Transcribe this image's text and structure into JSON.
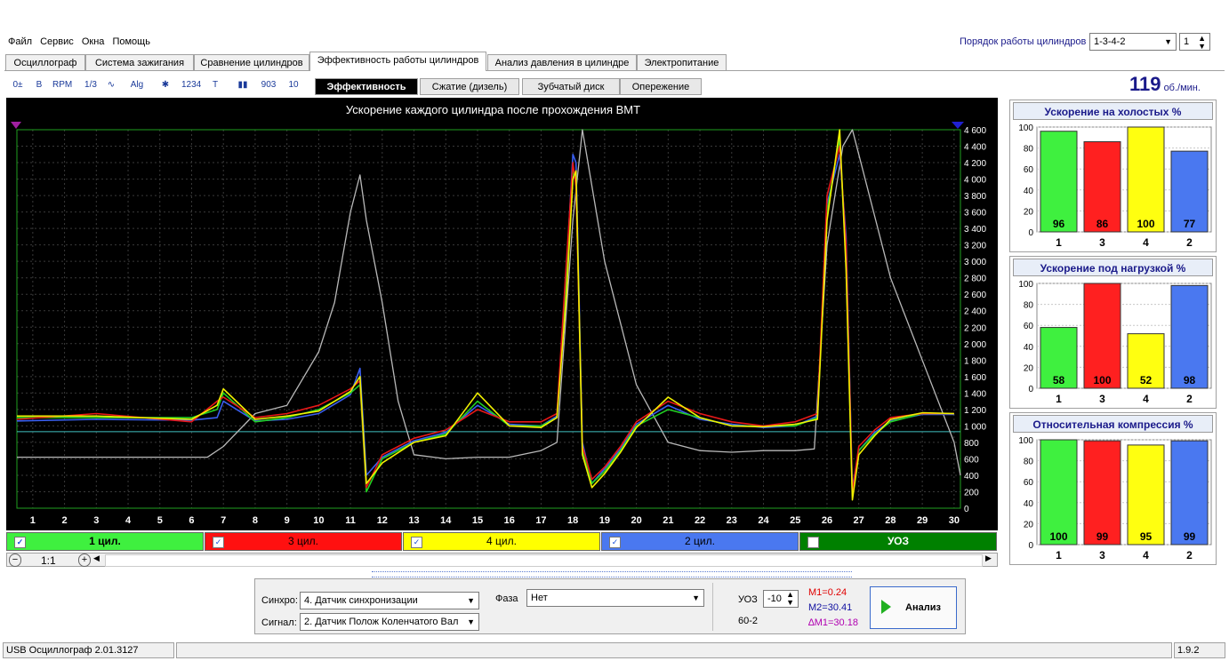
{
  "menu": [
    "Файл",
    "Сервис",
    "Окна",
    "Помощь"
  ],
  "cyl_order": {
    "label": "Порядок работы цилиндров",
    "value": "1-3-4-2",
    "spin_value": "1"
  },
  "tabs": [
    "Осциллограф",
    "Система зажигания",
    "Сравнение цилиндров",
    "Эффективность работы цилиндров",
    "Анализ давления в цилиндре",
    "Электропитание"
  ],
  "toolbar_icons": [
    "zero-offset-icon",
    "bold-icon",
    "rpm-icon",
    "range-icon",
    "curve-icon",
    "algorithm-icon",
    "filter-icon",
    "numbering-icon",
    "marker-icon",
    "bars-icon",
    "wave-icon",
    "level-icon"
  ],
  "toolbar_icon_glyphs": [
    "0±",
    "B",
    "RPM",
    "1/3",
    "∿",
    "Alg",
    "✱",
    "1234",
    "T",
    "▮▮",
    "903",
    "10"
  ],
  "subtabs": [
    "Эффективность",
    "Сжатие (дизель)",
    "Зубчатый диск",
    "Опережение"
  ],
  "rpm": {
    "value": "119",
    "unit": "об./мин."
  },
  "chart_data": {
    "type": "line",
    "title": "Ускорение каждого цилиндра после прохождения ВМТ",
    "x_ticks": [
      "1",
      "2",
      "3",
      "4",
      "5",
      "6",
      "7",
      "8",
      "9",
      "10",
      "11",
      "12",
      "13",
      "14",
      "15",
      "16",
      "17",
      "18",
      "19",
      "20",
      "21",
      "22",
      "23",
      "24",
      "25",
      "26",
      "27",
      "28",
      "29",
      "30"
    ],
    "xlim": [
      0.5,
      30.2
    ],
    "ylim": [
      0,
      4600
    ],
    "y_ticks": [
      "0",
      "200",
      "400",
      "600",
      "800",
      "1 000",
      "1 200",
      "1 400",
      "1 600",
      "1 800",
      "2 000",
      "2 200",
      "2 400",
      "2 600",
      "2 800",
      "3 000",
      "3 200",
      "3 400",
      "3 600",
      "3 800",
      "4 000",
      "4 200",
      "4 400",
      "4 600"
    ],
    "reference_line": 930,
    "grid": true,
    "series": [
      {
        "name": "1 цил.",
        "color": "#22d022",
        "x": [
          0.5,
          3,
          6,
          6.8,
          7,
          8,
          9,
          10,
          11,
          11.3,
          11.5,
          12,
          13,
          14,
          15,
          16,
          17,
          17.5,
          17.8,
          18,
          18.1,
          18.3,
          18.6,
          19,
          19.5,
          20,
          21,
          22,
          23,
          24,
          25,
          25.7,
          26,
          26.4,
          26.6,
          26.8,
          27,
          27.5,
          28,
          29,
          30
        ],
        "y": [
          1100,
          1100,
          1100,
          1200,
          1400,
          1050,
          1100,
          1200,
          1400,
          1500,
          200,
          600,
          800,
          900,
          1300,
          1000,
          1000,
          1100,
          2800,
          4100,
          4000,
          700,
          300,
          450,
          700,
          1000,
          1200,
          1100,
          1000,
          1000,
          1000,
          1100,
          3600,
          4500,
          3000,
          150,
          700,
          900,
          1050,
          1150,
          1150
        ]
      },
      {
        "name": "3 цил.",
        "color": "#e81818",
        "x": [
          0.5,
          3,
          6,
          6.8,
          7,
          8,
          9,
          10,
          11,
          11.3,
          11.5,
          12,
          13,
          14,
          15,
          16,
          17,
          17.5,
          17.8,
          18,
          18.1,
          18.3,
          18.6,
          19,
          19.5,
          20,
          21,
          22,
          23,
          24,
          25,
          25.7,
          26,
          26.4,
          26.6,
          26.8,
          27,
          27.5,
          28,
          29,
          30
        ],
        "y": [
          1080,
          1150,
          1050,
          1300,
          1350,
          1100,
          1150,
          1250,
          1450,
          1550,
          250,
          650,
          850,
          950,
          1200,
          1050,
          1050,
          1150,
          3000,
          4200,
          3900,
          750,
          350,
          500,
          750,
          1050,
          1300,
          1150,
          1050,
          1000,
          1050,
          1150,
          3800,
          4400,
          3200,
          200,
          750,
          950,
          1100,
          1150,
          1150
        ]
      },
      {
        "name": "4 цил.",
        "color": "#f0f000",
        "x": [
          0.5,
          3,
          6,
          6.8,
          7,
          8,
          9,
          10,
          11,
          11.3,
          11.5,
          12,
          13,
          14,
          15,
          16,
          17,
          17.5,
          17.8,
          18,
          18.1,
          18.3,
          18.6,
          19,
          19.5,
          20,
          21,
          22,
          23,
          24,
          25,
          25.7,
          26,
          26.4,
          26.6,
          26.8,
          27,
          27.5,
          28,
          29,
          30
        ],
        "y": [
          1120,
          1120,
          1080,
          1250,
          1450,
          1080,
          1120,
          1180,
          1420,
          1600,
          300,
          550,
          800,
          880,
          1400,
          1000,
          980,
          1100,
          2600,
          4000,
          4100,
          650,
          250,
          420,
          680,
          980,
          1350,
          1100,
          1000,
          990,
          1020,
          1080,
          3500,
          4600,
          2900,
          100,
          650,
          880,
          1080,
          1160,
          1150
        ]
      },
      {
        "name": "2 цил.",
        "color": "#3a5ff0",
        "x": [
          0.5,
          3,
          6,
          6.8,
          7,
          8,
          9,
          10,
          11,
          11.3,
          11.5,
          12,
          13,
          14,
          15,
          16,
          17,
          17.5,
          17.8,
          18,
          18.1,
          18.3,
          18.6,
          19,
          19.5,
          20,
          21,
          22,
          23,
          24,
          25,
          25.7,
          26,
          26.4,
          26.6,
          26.8,
          27,
          27.5,
          28,
          29,
          30
        ],
        "y": [
          1060,
          1080,
          1070,
          1100,
          1300,
          1060,
          1080,
          1150,
          1380,
          1700,
          400,
          620,
          820,
          920,
          1250,
          1020,
          1000,
          1120,
          2900,
          4300,
          4200,
          800,
          300,
          480,
          720,
          1020,
          1250,
          1080,
          1020,
          980,
          1000,
          1120,
          3700,
          4300,
          3300,
          250,
          700,
          920,
          1060,
          1140,
          1140
        ]
      },
      {
        "name": "УОЗ",
        "color": "#b8b8b8",
        "x": [
          0.5,
          3,
          6,
          6.5,
          7,
          8,
          9,
          10,
          10.5,
          11,
          11.3,
          11.5,
          12,
          12.5,
          13,
          14,
          15,
          16,
          17,
          17.5,
          18,
          18.3,
          19,
          20,
          21,
          22,
          23,
          24,
          25,
          25.6,
          26,
          26.5,
          26.8,
          27,
          28,
          29,
          30,
          30.2
        ],
        "y": [
          620,
          620,
          620,
          620,
          750,
          1150,
          1250,
          1900,
          2500,
          3600,
          4050,
          3500,
          2500,
          1300,
          650,
          600,
          620,
          620,
          700,
          800,
          3500,
          4600,
          3000,
          1500,
          800,
          700,
          680,
          700,
          700,
          720,
          3200,
          4400,
          4600,
          4300,
          2800,
          1800,
          800,
          400
        ]
      }
    ]
  },
  "lanes": [
    {
      "label": "1 цил.",
      "checked": "✓",
      "color": "#3ff03f"
    },
    {
      "label": "3 цил.",
      "checked": "✓",
      "color": "#ff1010"
    },
    {
      "label": "4 цил.",
      "checked": "✓",
      "color": "#ffff00"
    },
    {
      "label": "2 цил.",
      "checked": "✓",
      "color": "#4a78f0"
    },
    {
      "label": "УОЗ",
      "checked": "",
      "color": "#008000"
    }
  ],
  "zoom": {
    "ratio": "1:1",
    "minus": "−",
    "plus": "+"
  },
  "panels": [
    {
      "title": "Ускорение на холостых %",
      "categories": [
        "1",
        "3",
        "4",
        "2"
      ],
      "values": [
        96,
        86,
        100,
        77
      ],
      "y_ticks": [
        "0",
        "20",
        "40",
        "60",
        "80",
        "100"
      ],
      "ylim": [
        0,
        100
      ]
    },
    {
      "title": "Ускорение под нагрузкой %",
      "categories": [
        "1",
        "3",
        "4",
        "2"
      ],
      "values": [
        58,
        100,
        52,
        98
      ],
      "y_ticks": [
        "0",
        "20",
        "40",
        "60",
        "80",
        "100"
      ],
      "ylim": [
        0,
        100
      ]
    },
    {
      "title": "Относительная компрессия %",
      "categories": [
        "1",
        "3",
        "4",
        "2"
      ],
      "values": [
        100,
        99,
        95,
        99
      ],
      "y_ticks": [
        "0",
        "20",
        "40",
        "60",
        "80",
        "100"
      ],
      "ylim": [
        0,
        100
      ]
    }
  ],
  "bar_colors": [
    "#3ff03f",
    "#ff2020",
    "#ffff10",
    "#4a78f0"
  ],
  "controls": {
    "sync_label": "Синхро:",
    "sync_value": "4.  Датчик синхронизации",
    "signal_label": "Сигнал:",
    "signal_value": "2.  Датчик Полож Коленчатого Вал",
    "phase_label": "Фаза",
    "phase_value": "Нет",
    "uoz_label": "УОЗ",
    "uoz_value": "-10",
    "wheel": "60-2",
    "m1": "M1=0.24",
    "m2": "M2=30.41",
    "dm1": "∆M1=30.18",
    "analyze": "Анализ"
  },
  "status": {
    "app": "USB Осциллограф  2.01.3127",
    "version": "1.9.2"
  }
}
